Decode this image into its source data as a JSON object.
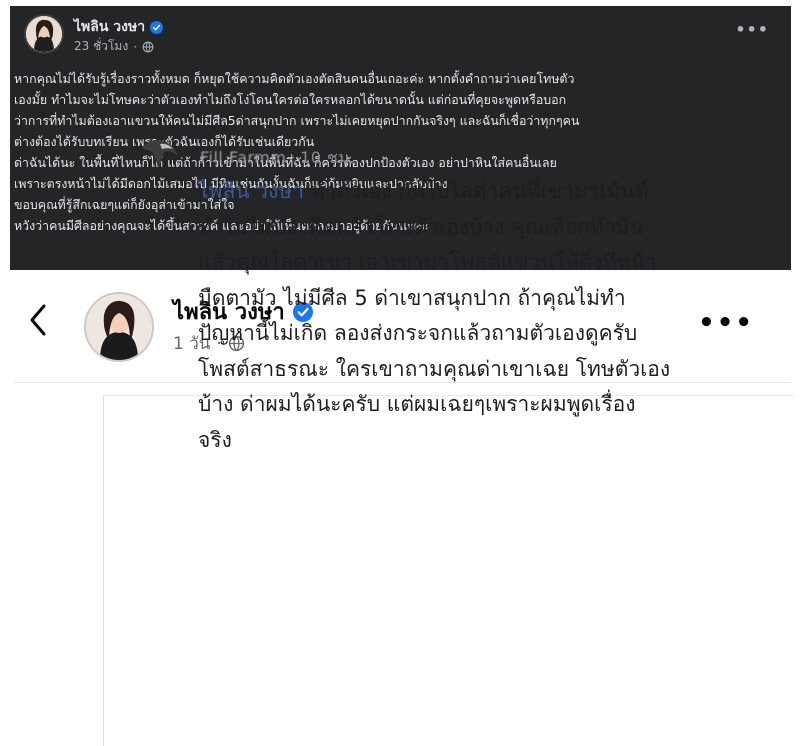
{
  "top_post": {
    "author": "ไพลิน วงษา",
    "time": "23 ชั่วโมง",
    "separator": "·",
    "more": "•••",
    "lines": [
      "หากคุณไม่ได้รับรู้เรื่องราวทั้งหมด ก็หยุดใช้ความคิดตัวเองตัดสินคนอื่นเถอะค่ะ หากตั้งคำถามว่าเคยโทษตัว",
      "เองมั้ย ทำไมจะไม่โทษคะว่าตัวเองทำไมถึงโง่โดนใครต่อใครหลอกได้ขนาดนั้น แต่ก่อนที่คุยจะพูดหรือบอก",
      "ว่าการที่ทำไมต้องเอาแขวนให้คนไม่มีศีล5ด่าสนุกปาก เพราะไม่เคยหยุดปากกันจริงๆ และฉันก็เชื่อว่าทุกๆคน",
      "ต่างต้องได้รับบทเรียน เพราะตัวฉันเองก็ได้รับเช่นเดียวกัน",
      "ด่าฉันได้นะ ในพื้นที่ไหนก็ได้ แต่ถ้าก้าวเข้ามาในพื้นที่ฉัน ก็ควรต้องปกป้องตัวเอง อย่าปาหินใส่คนอื่นเลย",
      "เพราะตรงหน้าไม่ได้มีดอกไม้เสมอไป มีหินเช่นกันงั้นฉันก็แค่ก้มหยิบและปากลับบ้าง",
      "ขอบคุณที่รู้สึกเฉยๆแต่ก็ยังอุส่าเข้ามาใส่ใจ",
      "หวังว่าคนมีศีลอย่างคุณจะได้ขึ้นสวรรค์ และอย่าให้เห็นตกลงมาอยู่ด้วยกันนะคะ"
    ]
  },
  "bottom_post": {
    "back": "<",
    "author": "ไพลิน วงษา",
    "time": "1 วัน",
    "separator": "·",
    "more": "•••",
    "comment": {
      "commenter_partial": "Fill Farmm",
      "separator": "·",
      "time": "10 ชม.",
      "mention": "ไพลิน วงษา",
      "first_line_rest": " ทำตัวเอง กันไปไล่ด่าคนที่เขามาเม้นต์",
      "lines": [
        "ทำไมไม่บองคิดแล้วโทษตัวเองบ้าง คุณเลือกทำมัน",
        "แล้วคุณไลด่าเขา เอาเขามาโพสต์แขวนให้ติ่งที่หน้า",
        "มืดตามัว ไม่มีศีล 5 ด่าเขาสนุกปาก  ถ้าคุณไม่ทำ",
        "ปัญหานี้ไม่เกิด  ลองส่งกระจกแล้วถามตัวเองดูครับ",
        "โพสต์สาธรณะ ใครเขาถามคุณด่าเขาเฉย โทษตัวเอง",
        "บ้าง  ด่าผมได้นะครับ  แต่ผมเฉยๆเพราะผมพูดเรื่อง",
        "จริง"
      ]
    }
  },
  "colors": {
    "dark_bg": "#242526",
    "light_bg": "#ffffff",
    "verified": "#1877f2",
    "mention": "#385898"
  }
}
